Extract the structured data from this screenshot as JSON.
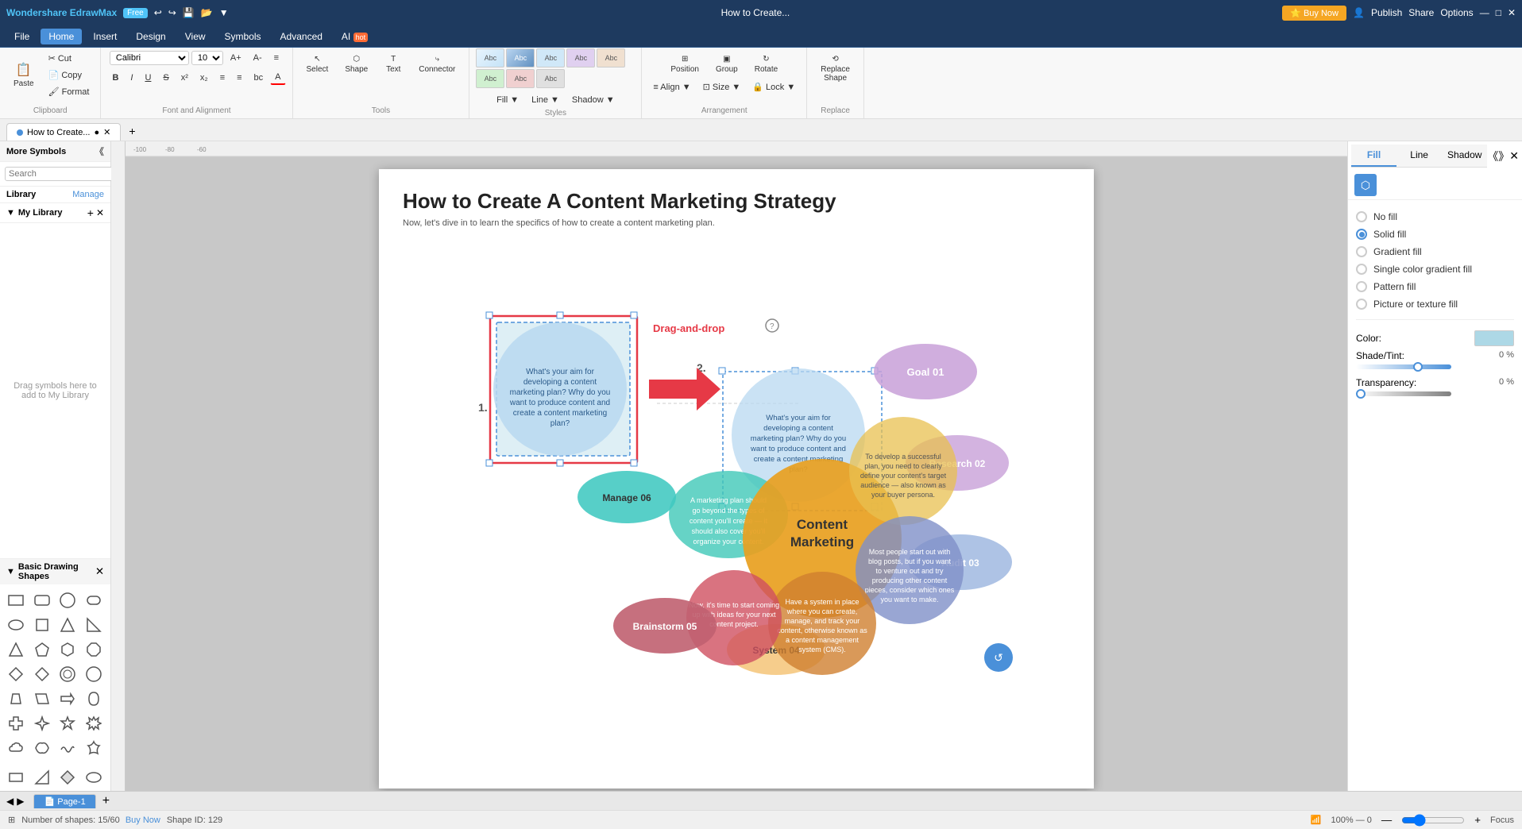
{
  "app": {
    "name": "Wondershare EdrawMax",
    "version": "Free",
    "title": "How to Create...",
    "tab_modified": true
  },
  "titlebar": {
    "logo": "Wondershare EdrawMax",
    "badge": "Free",
    "buy_now": "⭐ Buy Now",
    "avatar": "👤",
    "minimize": "—",
    "maximize": "□",
    "close": "✕",
    "publish": "Publish",
    "share": "Share",
    "options": "Options"
  },
  "menu": {
    "items": [
      "File",
      "Home",
      "Insert",
      "Design",
      "View",
      "Symbols",
      "Advanced",
      "AI"
    ]
  },
  "ribbon": {
    "clipboard": {
      "label": "Clipboard",
      "paste_icon": "📋",
      "cut_icon": "✂",
      "copy_icon": "📄",
      "format_painter_icon": "🖌"
    },
    "font": {
      "label": "Font and Alignment",
      "family": "Calibri",
      "size": "10",
      "bold": "B",
      "italic": "I",
      "underline": "U",
      "strikethrough": "S",
      "superscript": "x²",
      "subscript": "x₂",
      "bullets": "≡",
      "align": "≡",
      "font_color": "A",
      "fill_color": "A"
    },
    "tools": {
      "label": "Tools",
      "select": "Select",
      "shape": "Shape",
      "text": "Text",
      "connector": "Connector"
    },
    "styles_label": "Styles",
    "styles": [
      "Abc",
      "Abc",
      "Abc",
      "Abc",
      "Abc",
      "Abc",
      "Abc",
      "Abc"
    ],
    "line": "Line",
    "fill": "Fill",
    "shadow": "Shadow",
    "arrangement": {
      "label": "Arrangement",
      "position": "Position",
      "group": "Group",
      "rotate": "Rotate",
      "align": "Align",
      "size": "Size",
      "lock": "Lock"
    },
    "replace": {
      "label": "Replace",
      "replace_shape": "Replace Shape"
    }
  },
  "tabs": {
    "active": "How to Create...",
    "add": "+"
  },
  "left_panel": {
    "more_symbols": "More Symbols",
    "search": {
      "placeholder": "Search",
      "button": "Search"
    },
    "library": "Library",
    "manage": "Manage",
    "my_library": "My Library",
    "drag_hint": "Drag symbols here to add to My Library",
    "basic_shapes": "Basic Drawing Shapes"
  },
  "diagram": {
    "title": "How to Create A Content Marketing Strategy",
    "subtitle": "Now, let's dive in to learn the specifics of how to create a content marketing plan.",
    "label1": "1.",
    "label2": "2.",
    "drag_drop": "Drag-and-drop",
    "bubbles": [
      {
        "id": "center",
        "label": "Content\nMarketing",
        "color": "#e8a020",
        "text_color": "#333"
      },
      {
        "id": "goal",
        "label": "Goal 01",
        "color": "#c8a0d8",
        "text_color": "#333"
      },
      {
        "id": "research",
        "label": "Research 02",
        "color": "#c8a0d8",
        "text_color": "#333"
      },
      {
        "id": "audit",
        "label": "Audit 03",
        "color": "#a0b8e0",
        "text_color": "#333"
      },
      {
        "id": "system",
        "label": "System 04",
        "color": "#f5c8a0",
        "text_color": "#333"
      },
      {
        "id": "brainstorm",
        "label": "Brainstorm 05",
        "color": "#d08080",
        "text_color": "white"
      },
      {
        "id": "manage",
        "label": "Manage 06",
        "color": "#60c8c0",
        "text_color": "#333"
      }
    ],
    "descriptions": {
      "goal": "What's your aim for developing a content marketing plan? Why do you want to produce content and create a content marketing plan?",
      "research": "What's your aim for developing a content marketing plan? Why do you want to produce content and create a content marketing plan?",
      "audience": "To develop a successful plan, you need to clearly define your content's target audience — also known as your buyer persona.",
      "audit": "Most people start out with blog posts, but if you want to venture out and try producing other content pieces, consider which ones you want to make.",
      "system": "Have a system in place where you can create, manage, and track your content, otherwise known as a content management system (CMS).",
      "ideas": "Now, it's time to start coming up with ideas for your next content project.",
      "manage": "A marketing plan should go beyond the types of content you'll create — it should also cover you'll organize your content."
    },
    "number_shapes": "Number of shapes: 15/60",
    "buy_now_link": "Buy Now",
    "shape_id": "Shape ID: 129"
  },
  "right_panel": {
    "tabs": [
      "Fill",
      "Line",
      "Shadow"
    ],
    "active_tab": "Fill",
    "fill_options": [
      {
        "id": "no_fill",
        "label": "No fill",
        "selected": false
      },
      {
        "id": "solid_fill",
        "label": "Solid fill",
        "selected": true
      },
      {
        "id": "gradient_fill",
        "label": "Gradient fill",
        "selected": false
      },
      {
        "id": "single_gradient",
        "label": "Single color gradient fill",
        "selected": false
      },
      {
        "id": "pattern_fill",
        "label": "Pattern fill",
        "selected": false
      },
      {
        "id": "picture_fill",
        "label": "Picture or texture fill",
        "selected": false
      }
    ],
    "color_label": "Color:",
    "color_value": "#add8e6",
    "shade_label": "Shade/Tint:",
    "shade_value": "0 %",
    "transparency_label": "Transparency:",
    "transparency_value": "0 %"
  },
  "statusbar": {
    "page": "Page-1",
    "zoom_in": "+",
    "zoom_out": "-",
    "zoom_level": "100%",
    "fit": "Focus",
    "shape_count": "Number of shapes: 15/60",
    "buy_now": "Buy Now",
    "shape_id": "Shape ID: 129",
    "zoom_value": "100% — 0"
  },
  "page_tabs": {
    "items": [
      "Page-1"
    ],
    "add": "+"
  }
}
